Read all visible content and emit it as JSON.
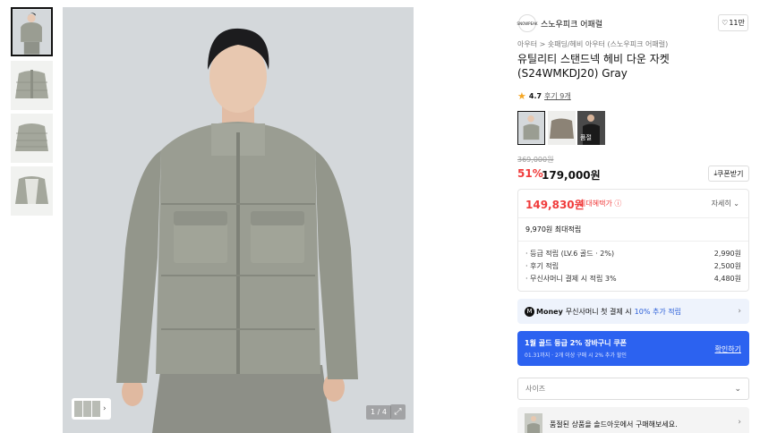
{
  "gallery": {
    "thumbnails": [
      {
        "name": "front-model-thumb"
      },
      {
        "name": "front-flat-thumb"
      },
      {
        "name": "back-flat-thumb"
      },
      {
        "name": "inner-flat-thumb"
      }
    ],
    "counter": "1 / 4",
    "expand_icon": "expand-icon"
  },
  "brand": {
    "logo_text": "SNOWPEAK",
    "name": "스노우피크 어패럴",
    "likes": "11만"
  },
  "breadcrumb": "아우터 > 숏패딩/헤비 아우터 (스노우피크 어패럴)",
  "product": {
    "title": "유틸리티 스탠드넥 헤비 다운 자켓 (S24WMKDJ20) Gray",
    "rating": "4.7",
    "reviews": "후기 9개"
  },
  "colors": [
    {
      "name": "Gray",
      "selected": true
    },
    {
      "name": "Khaki",
      "selected": false
    },
    {
      "name": "Black",
      "tag": "품절",
      "selected": false
    }
  ],
  "price": {
    "original": "369,000원",
    "discount": "51%",
    "sale": "179,000원",
    "coupon_label": "쿠폰받기"
  },
  "benefit": {
    "max_price": "149,830원",
    "max_label": "최대혜택가",
    "detail_label": "자세히",
    "points_total": "9,970원 최대적립",
    "rows": [
      {
        "label": "· 등급 적립 (LV.6 골드 · 2%)",
        "value": "2,990원"
      },
      {
        "label": "· 후기 적립",
        "value": "2,500원"
      },
      {
        "label": "· 무신사머니 결제 시 적립 3%",
        "value": "4,480원"
      }
    ]
  },
  "money_banner": {
    "icon_letter": "M",
    "brand_word": "Money",
    "text": "무신사머니 첫 결제 시",
    "highlight": "10% 추가 적립"
  },
  "coupon_banner": {
    "title": "1월 골드 등급 2% 장바구니 쿠폰",
    "subtitle": "01.31까지 · 2개 이상 구매 시 2% 추가 할인",
    "link": "확인하기"
  },
  "size_select": {
    "placeholder": "사이즈"
  },
  "soldout": {
    "text": "품절된 상품을 솔드아웃에서 구매해보세요."
  },
  "colors_palette": {
    "accent_red": "#f03b3b",
    "accent_blue": "#2c62f0",
    "jacket": "#9a9d92"
  }
}
